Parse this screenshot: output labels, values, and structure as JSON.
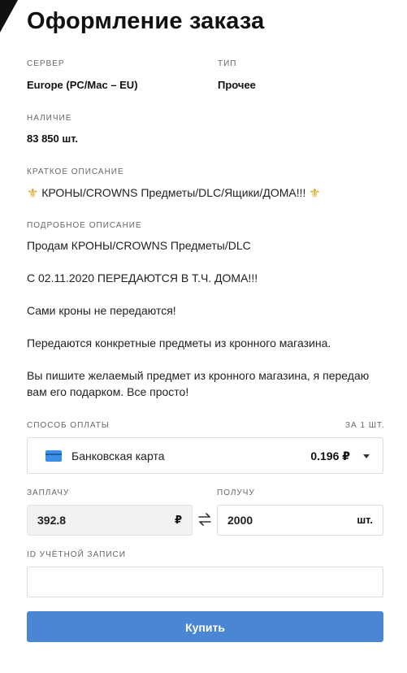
{
  "page": {
    "title": "Оформление заказа"
  },
  "fields": {
    "server": {
      "label": "СЕРВЕР",
      "value": "Europe (PC/Mac – EU)"
    },
    "type": {
      "label": "ТИП",
      "value": "Прочее"
    },
    "stock": {
      "label": "НАЛИЧИЕ",
      "value": "83 850 шт."
    },
    "short_desc": {
      "label": "КРАТКОЕ ОПИСАНИЕ",
      "value": "КРОНЫ/CROWNS Предметы/DLC/Ящики/ДОМА!!!",
      "icon": "fleur-de-lis-icon"
    },
    "long_desc": {
      "label": "ПОДРОБНОЕ ОПИСАНИЕ",
      "paragraphs": [
        "Продам КРОНЫ/CROWNS Предметы/DLC",
        "С 02.11.2020 ПЕРЕДАЮТСЯ В Т.Ч. ДОМА!!!",
        "Сами кроны не передаются!",
        "Передаются конкретные предметы из кронного магазина.",
        "Вы пишите желаемый предмет из кронного магазина, я передаю вам его подарком. Все просто!"
      ]
    }
  },
  "payment": {
    "label": "СПОСОБ ОПЛАТЫ",
    "per_unit_label": "ЗА 1 ШТ.",
    "method": "Банковская карта",
    "method_icon": "bank-card-icon",
    "price": "0.196 ₽"
  },
  "exchange": {
    "pay_label": "ЗАПЛАЧУ",
    "pay_value": "392.8",
    "pay_unit": "₽",
    "get_label": "ПОЛУЧУ",
    "get_value": "2000",
    "get_unit": "шт."
  },
  "account": {
    "label": "ID УЧЁТНОЙ ЗАПИСИ",
    "value": ""
  },
  "buy_button": {
    "label": "Купить"
  },
  "colors": {
    "accent": "#4a86d4",
    "card": "#3d8ee6",
    "fleur": "#d4a017"
  }
}
